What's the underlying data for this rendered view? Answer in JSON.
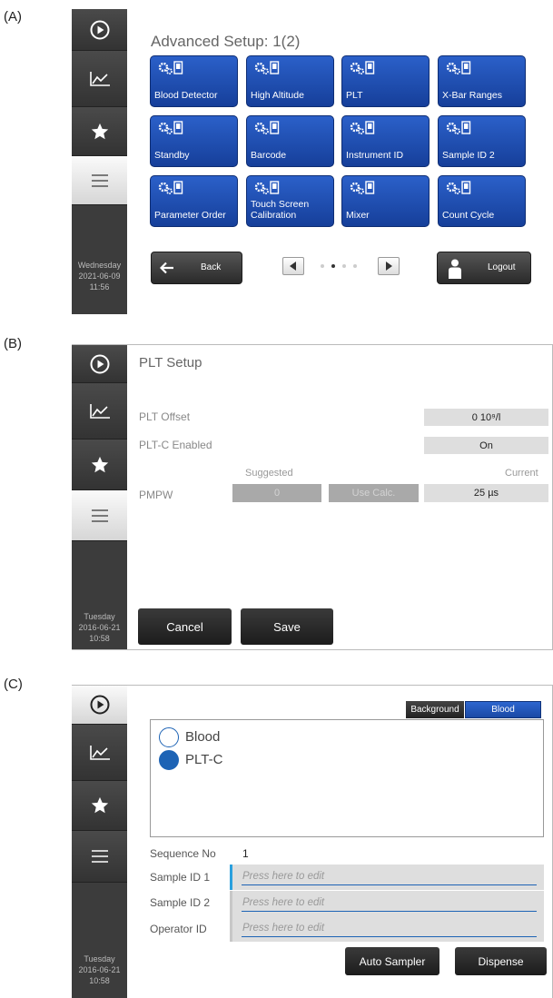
{
  "panels": {
    "a": {
      "letter": "(A)",
      "date": {
        "day": "Wednesday",
        "date": "2021-06-09",
        "time": "11:56"
      },
      "title": "Advanced Setup: 1(2)",
      "tiles": [
        {
          "label": "Blood Detector"
        },
        {
          "label": "High Altitude"
        },
        {
          "label": "PLT"
        },
        {
          "label": "X-Bar Ranges"
        },
        {
          "label": "Standby"
        },
        {
          "label": "Barcode"
        },
        {
          "label": "Instrument ID"
        },
        {
          "label": "Sample ID 2"
        },
        {
          "label": "Parameter Order"
        },
        {
          "label": "Touch Screen Calibration"
        },
        {
          "label": "Mixer"
        },
        {
          "label": "Count Cycle"
        }
      ],
      "back_label": "Back",
      "logout_label": "Logout",
      "pager": {
        "current_page": 2,
        "total_pages": 4
      }
    },
    "b": {
      "letter": "(B)",
      "date": {
        "day": "Tuesday",
        "date": "2016-06-21",
        "time": "10:58"
      },
      "title": "PLT Setup",
      "plt_offset_label": "PLT Offset",
      "plt_offset_value": "0 10⁹/l",
      "pltc_label": "PLT-C Enabled",
      "pltc_value": "On",
      "suggested_label": "Suggested",
      "current_label": "Current",
      "pmpw_label": "PMPW",
      "pmpw_suggested": "0",
      "use_calc_label": "Use Calc.",
      "pmpw_current": "25 µs",
      "cancel_label": "Cancel",
      "save_label": "Save"
    },
    "c": {
      "letter": "(C)",
      "date": {
        "day": "Tuesday",
        "date": "2016-06-21",
        "time": "10:58"
      },
      "tab_background": "Background",
      "tab_blood": "Blood",
      "options": [
        {
          "label": "Blood",
          "selected": false
        },
        {
          "label": "PLT-C",
          "selected": true
        }
      ],
      "sequence_label": "Sequence No",
      "sequence_value": "1",
      "sample_id1_label": "Sample ID 1",
      "sample_id2_label": "Sample ID 2",
      "operator_label": "Operator ID",
      "placeholder": "Press here to edit",
      "auto_sampler_label": "Auto Sampler",
      "dispense_label": "Dispense"
    }
  },
  "colors": {
    "sidebar": "#3c3c3c",
    "tile_blue": "#1f4fb3",
    "accent_blue": "#1d63b5",
    "focus_cyan": "#2aa0de"
  },
  "icons": [
    "play-icon",
    "chart-icon",
    "star-icon",
    "menu-icon",
    "gear-device-icon",
    "arrow-left-icon",
    "user-icon",
    "triangle-left-icon",
    "triangle-right-icon"
  ]
}
